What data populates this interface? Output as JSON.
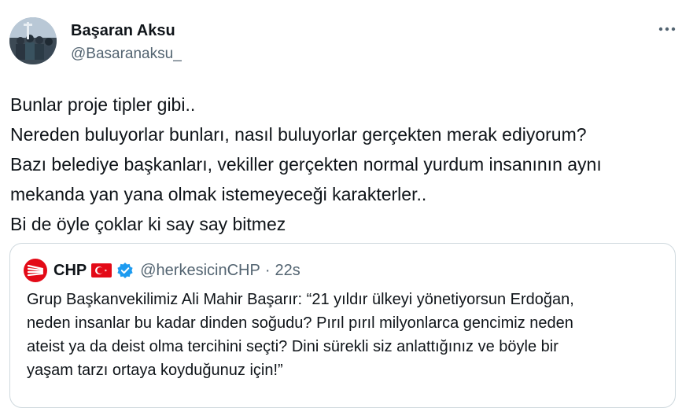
{
  "author": {
    "name": "Başaran Aksu",
    "handle": "@Basaranaksu_"
  },
  "tweet": {
    "lines": [
      "Bunlar proje tipler gibi..",
      "Nereden buluyorlar bunları, nasıl buluyorlar gerçekten merak ediyorum?",
      "Bazı belediye başkanları, vekiller gerçekten normal yurdum insanının aynı",
      "mekanda yan yana olmak istemeyeceği karakterler..",
      "Bi de öyle çoklar ki say say bitmez"
    ]
  },
  "quote": {
    "name": "CHP",
    "handle": "@herkesicinCHP",
    "separator": "·",
    "time": "22s",
    "lines": [
      "Grup Başkanvekilimiz Ali Mahir Başarır: “21 yıldır ülkeyi yönetiyorsun Erdoğan,",
      "neden insanlar bu kadar dinden soğudu? Pırıl pırıl milyonlarca gencimiz neden",
      "ateist ya da deist olma tercihini seçti? Dini sürekli siz anlattığınız ve böyle bir",
      "yaşam tarzı ortaya koyduğunuz için!”"
    ]
  },
  "icons": {
    "avatar": "avatar-photo",
    "more": "more-horizontal-icon",
    "logo": "chp-logo-icon",
    "flag": "turkey-flag-icon",
    "verified": "verified-badge-icon"
  },
  "colors": {
    "text": "#0f1419",
    "secondary": "#536471",
    "border": "#cfd9de",
    "verified": "#1d9bf0",
    "chp_red": "#e30a17"
  }
}
